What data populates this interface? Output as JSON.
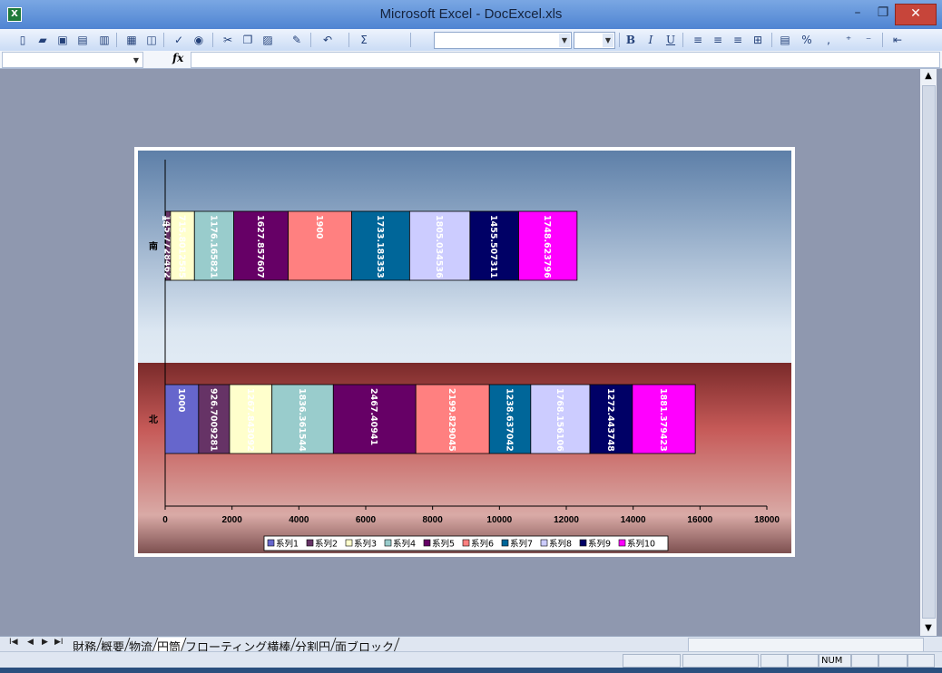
{
  "window": {
    "title": "Microsoft Excel - DocExcel.xls",
    "app_icon": "X",
    "minimize": "–",
    "maximize": "❐",
    "close": "✕"
  },
  "formula_bar": {
    "fx": "fx"
  },
  "toolbar": {
    "bold": "B",
    "italic": "I",
    "underline": "U",
    "sum": "Σ",
    "percent": "%",
    "comma": ","
  },
  "chart_data": {
    "type": "bar",
    "orientation": "horizontal",
    "stacked": true,
    "categories": [
      "北",
      "南"
    ],
    "series": [
      {
        "name": "系列1",
        "color": "#6666cc",
        "values": [
          1000,
          14.5
        ]
      },
      {
        "name": "系列2",
        "color": "#663366",
        "values": [
          926.7009281,
          145.7728462
        ]
      },
      {
        "name": "系列3",
        "color": "#ffffcc",
        "values": [
          1267.843092,
          715.8012585
        ]
      },
      {
        "name": "系列4",
        "color": "#99cccc",
        "values": [
          1836.361544,
          1176.165821
        ]
      },
      {
        "name": "系列5",
        "color": "#660066",
        "values": [
          2467.40941,
          1627.857607
        ]
      },
      {
        "name": "系列6",
        "color": "#ff8080",
        "values": [
          2199.829045,
          1900
        ]
      },
      {
        "name": "系列7",
        "color": "#006699",
        "values": [
          1238.637042,
          1733.183353
        ]
      },
      {
        "name": "系列8",
        "color": "#ccccff",
        "values": [
          1768.156106,
          1805.034536
        ]
      },
      {
        "name": "系列9",
        "color": "#000066",
        "values": [
          1272.443748,
          1455.507311
        ]
      },
      {
        "name": "系列10",
        "color": "#ff00ff",
        "values": [
          1881.379423,
          1748.623796
        ]
      }
    ],
    "data_labels": {
      "北": [
        "1000",
        "926.7009281",
        "1267.843092",
        "1836.361544",
        "2467.40941",
        "2199.829045",
        "1238.637042",
        "1768.156106",
        "1272.443748",
        "1881.379423"
      ],
      "南": [
        "14",
        "145.7728462",
        "715.8012585",
        "1176.165821",
        "1627.857607",
        "1900",
        "1733.183353",
        "1805.034536",
        "1455.507311",
        "1748.623796"
      ]
    },
    "x_ticks": [
      "0",
      "2000",
      "4000",
      "6000",
      "8000",
      "10000",
      "12000",
      "14000",
      "16000",
      "18000"
    ],
    "xlim": [
      0,
      18000
    ],
    "legend_position": "bottom",
    "grid": false
  },
  "sheet_tabs": {
    "nav": [
      "I◀",
      "◀",
      "▶",
      "▶I"
    ],
    "tabs": [
      {
        "label": "財務",
        "active": false
      },
      {
        "label": "概要",
        "active": false
      },
      {
        "label": "物流",
        "active": false
      },
      {
        "label": "円筒",
        "active": true
      },
      {
        "label": "フローティング横棒",
        "active": false
      },
      {
        "label": "分割円",
        "active": false
      },
      {
        "label": "面ブロック",
        "active": false
      }
    ]
  },
  "status_bar": {
    "num": "NUM"
  }
}
